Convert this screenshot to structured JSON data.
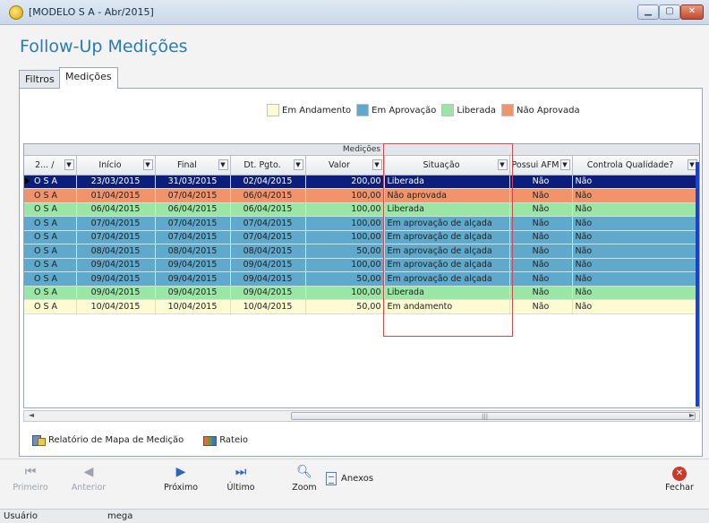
{
  "window": {
    "title": "[MODELO S A - Abr/2015]"
  },
  "page_title": "Follow-Up Medições",
  "tabs": [
    {
      "label": "Filtros"
    },
    {
      "label": "Medições"
    }
  ],
  "legend": [
    {
      "label": "Em Andamento",
      "color": "#fdfbd2"
    },
    {
      "label": "Em Aprovação",
      "color": "#5fa9cc"
    },
    {
      "label": "Liberada",
      "color": "#9ae6a4"
    },
    {
      "label": "Não Aprovada",
      "color": "#f2946b"
    }
  ],
  "grid": {
    "band_title": "Medições",
    "columns": [
      "2... /",
      "Início",
      "Final",
      "Dt. Pgto.",
      "Valor",
      "Situação",
      "Possui AFM",
      "Controla Qualidade?"
    ],
    "rows": [
      {
        "status": "selected",
        "cells": [
          "O S A",
          "23/03/2015",
          "31/03/2015",
          "02/04/2015",
          "200,00",
          "Liberada",
          "Não",
          "Não"
        ]
      },
      {
        "status": "nao",
        "cells": [
          "O S A",
          "01/04/2015",
          "07/04/2015",
          "06/04/2015",
          "100,00",
          "Não aprovada",
          "Não",
          "Não"
        ]
      },
      {
        "status": "lib",
        "cells": [
          "O S A",
          "06/04/2015",
          "06/04/2015",
          "06/04/2015",
          "100,00",
          "Liberada",
          "Não",
          "Não"
        ]
      },
      {
        "status": "apr",
        "cells": [
          "O S A",
          "07/04/2015",
          "07/04/2015",
          "07/04/2015",
          "100,00",
          "Em aprovação de alçada",
          "Não",
          "Não"
        ]
      },
      {
        "status": "apr",
        "cells": [
          "O S A",
          "07/04/2015",
          "07/04/2015",
          "07/04/2015",
          "100,00",
          "Em aprovação de alçada",
          "Não",
          "Não"
        ]
      },
      {
        "status": "apr",
        "cells": [
          "O S A",
          "08/04/2015",
          "08/04/2015",
          "08/04/2015",
          "50,00",
          "Em aprovação de alçada",
          "Não",
          "Não"
        ]
      },
      {
        "status": "apr",
        "cells": [
          "O S A",
          "09/04/2015",
          "09/04/2015",
          "09/04/2015",
          "100,00",
          "Em aprovação de alçada",
          "Não",
          "Não"
        ]
      },
      {
        "status": "apr",
        "cells": [
          "O S A",
          "09/04/2015",
          "09/04/2015",
          "09/04/2015",
          "50,00",
          "Em aprovação de alçada",
          "Não",
          "Não"
        ]
      },
      {
        "status": "lib",
        "cells": [
          "O S A",
          "09/04/2015",
          "09/04/2015",
          "09/04/2015",
          "100,00",
          "Liberada",
          "Não",
          "Não"
        ]
      },
      {
        "status": "and",
        "cells": [
          "O S A",
          "10/04/2015",
          "10/04/2015",
          "10/04/2015",
          "50,00",
          "Em andamento",
          "Não",
          "Não"
        ]
      }
    ]
  },
  "links": {
    "mapa": "Relatório de Mapa de Medição",
    "rateio": "Rateio"
  },
  "toolbar": {
    "primeiro": "Primeiro",
    "anterior": "Anterior",
    "proximo": "Próximo",
    "ultimo": "Último",
    "zoom": "Zoom",
    "anexos": "Anexos",
    "fechar": "Fechar"
  },
  "status": {
    "label": "Usuário",
    "value": "mega"
  },
  "icons": [
    "app-icon",
    "minimize-icon",
    "maximize-icon",
    "close-window-icon",
    "first-record-icon",
    "previous-record-icon",
    "next-record-icon",
    "last-record-icon",
    "zoom-icon",
    "attachment-icon",
    "close-icon",
    "map-report-icon",
    "rateio-icon"
  ]
}
